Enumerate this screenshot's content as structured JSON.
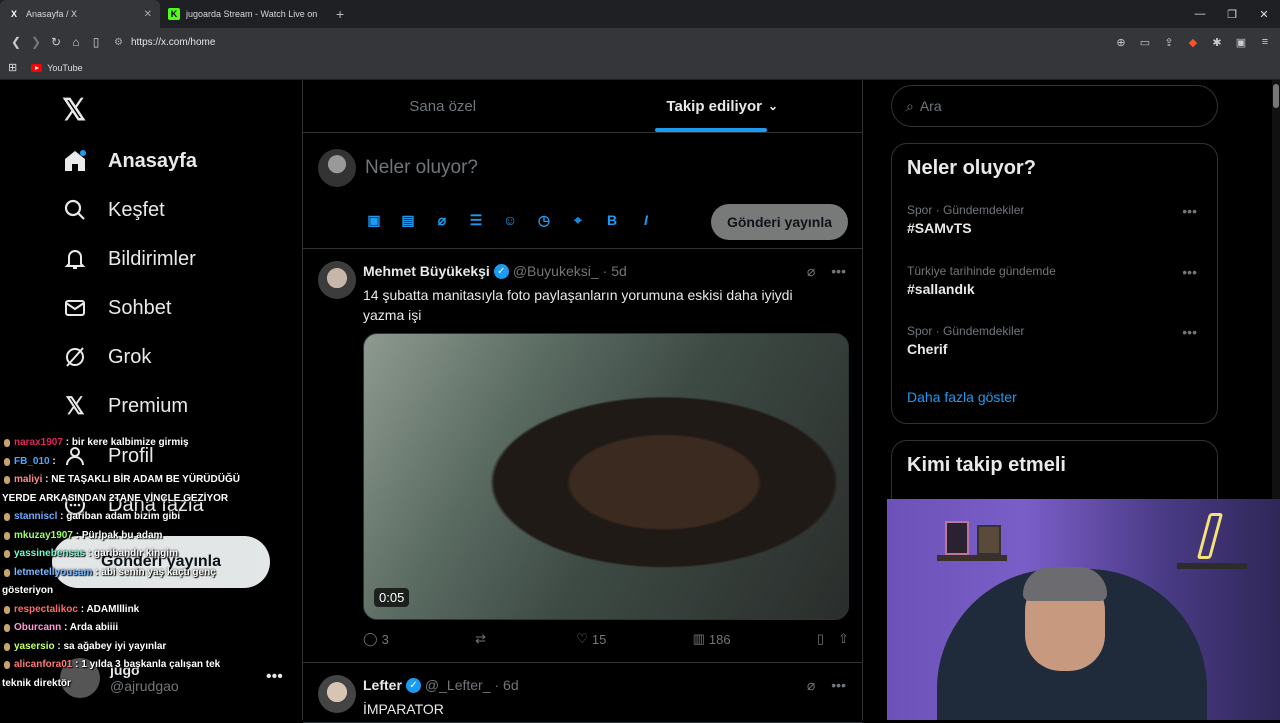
{
  "browser": {
    "tabs": [
      {
        "title": "Anasayfa / X",
        "favicon": "X",
        "close": "✕"
      },
      {
        "title": "jugoarda Stream - Watch Live on Kick",
        "favicon": "K"
      }
    ],
    "new_tab": "+",
    "url": "https://x.com/home",
    "bookmarks": [
      {
        "label": "YouTube"
      }
    ]
  },
  "sidebar": {
    "logo": "𝕏",
    "items": [
      {
        "label": "Anasayfa",
        "icon": "home-icon"
      },
      {
        "label": "Keşfet",
        "icon": "search-icon"
      },
      {
        "label": "Bildirimler",
        "icon": "bell-icon"
      },
      {
        "label": "Sohbet",
        "icon": "mail-icon"
      },
      {
        "label": "Grok",
        "icon": "grok-icon"
      },
      {
        "label": "Premium",
        "icon": "x-icon"
      },
      {
        "label": "Profil",
        "icon": "person-icon"
      },
      {
        "label": "Daha fazla",
        "icon": "more-icon"
      }
    ],
    "post_button": "Gönderi yayınla",
    "account": {
      "name": "jugo",
      "handle": "@ajrudgao",
      "menu": "•••"
    }
  },
  "chat": [
    {
      "user": "narax1907",
      "color": "#e0245e",
      "msg": ": bir kere kalbimize girmiş"
    },
    {
      "user": "FB_010",
      "color": "#4aa8ff",
      "msg": ":"
    },
    {
      "user": "maliyi",
      "color": "#ff8c8c",
      "msg": ": NE TAŞAKLI BİR ADAM BE YÜRÜDÜĞÜ YERDE ARKASINDAN 2TANE VİNÇLE GEZİYOR"
    },
    {
      "user": "stanniscl",
      "color": "#6fa8ff",
      "msg": ": gariban adam bizim gibi"
    },
    {
      "user": "mkuzay1907",
      "color": "#9bff6a",
      "msg": ": Pürlpak bu adam"
    },
    {
      "user": "yassinebensas",
      "color": "#6fffd2",
      "msg": ": garibandır kingim"
    },
    {
      "user": "letmetellyousam",
      "color": "#7bb7ff",
      "msg": ": abi senin yaş kaçtı genç gösteriyon"
    },
    {
      "user": "respectalikoc",
      "color": "#ff6b6b",
      "msg": ": ADAMlllink"
    },
    {
      "user": "Oburcann",
      "color": "#ff9ad5",
      "msg": ": Arda abiiii"
    },
    {
      "user": "yasersio",
      "color": "#c6ff6a",
      "msg": ": sa ağabey iyi yayınlar"
    },
    {
      "user": "alicanfora01",
      "color": "#ff7a7a",
      "msg": ": 1 yılda 3 başkanla çalışan tek teknik direktör"
    }
  ],
  "timeline": {
    "tabs": [
      "Sana özel",
      "Takip ediliyor"
    ],
    "compose": {
      "placeholder": "Neler oluyor?",
      "tools": [
        "image-icon",
        "gif-icon",
        "grok-icon",
        "list-icon",
        "emoji-icon",
        "schedule-icon",
        "location-icon",
        "bold-icon",
        "italic-icon"
      ],
      "tool_glyphs": [
        "▣",
        "▤",
        "⌀",
        "☰",
        "☺",
        "◷",
        "⌖",
        "B",
        "I"
      ],
      "post_button": "Gönderi yayınla"
    },
    "tweets": [
      {
        "name": "Mehmet Büyükekşi",
        "handle": "@Buyukeksi_",
        "age": "· 5d",
        "text": "14 şubatta manitasıyla foto paylaşanların yorumuna eskisi daha iyiydi yazma işi",
        "video_duration": "0:05",
        "replies": "3",
        "retweets": "",
        "likes": "15",
        "views": "186"
      },
      {
        "name": "Lefter",
        "handle": "@_Lefter_",
        "age": "· 6d",
        "text": "İMPARATOR"
      }
    ]
  },
  "right": {
    "search_placeholder": "Ara",
    "trends_title": "Neler oluyor?",
    "trends": [
      {
        "context": "Spor · Gündemdekiler",
        "topic": "#SAMvTS"
      },
      {
        "context": "Türkiye tarihinde gündemde",
        "topic": "#sallandık"
      },
      {
        "context": "Spor · Gündemdekiler",
        "topic": "Cherif"
      }
    ],
    "show_more": "Daha fazla göster",
    "who_to_follow": "Kimi takip etmeli"
  }
}
